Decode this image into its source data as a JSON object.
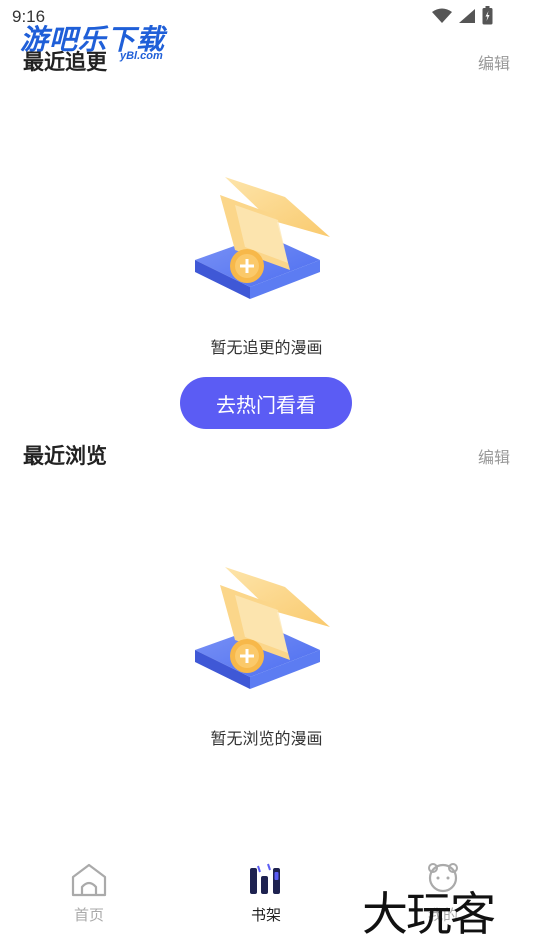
{
  "status_bar": {
    "time": "9:16",
    "icons": [
      "wifi-icon",
      "signal-icon",
      "battery-icon"
    ]
  },
  "watermark_top": {
    "main": "游吧乐下载",
    "sub": "yBl.com"
  },
  "recent_updates": {
    "title": "最近追更",
    "edit_label": "编辑",
    "empty_text": "暂无追更的漫画",
    "action_label": "去热门看看"
  },
  "recent_browse": {
    "title": "最近浏览",
    "edit_label": "编辑",
    "empty_text": "暂无浏览的漫画"
  },
  "bottom_nav": {
    "items": [
      {
        "label": "首页",
        "icon": "home-icon",
        "active": false
      },
      {
        "label": "书架",
        "icon": "bookshelf-icon",
        "active": true
      },
      {
        "label": "我的",
        "icon": "profile-icon",
        "active": false
      }
    ]
  },
  "watermark_bottom": "大玩客",
  "colors": {
    "accent": "#5b5cf4",
    "muted": "#999999",
    "watermark_blue": "#1f5fd8"
  }
}
